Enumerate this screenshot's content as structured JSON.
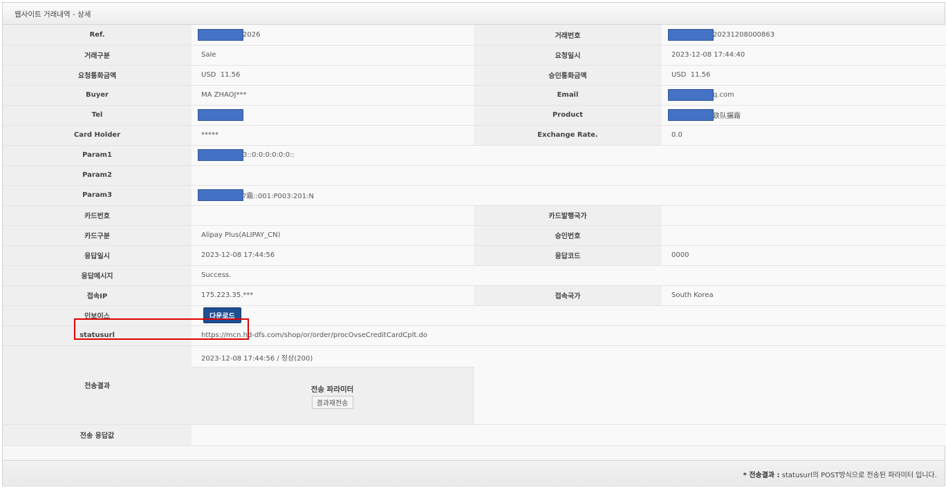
{
  "page": {
    "title": "웹사이트 거래내역 - 상세"
  },
  "rows": {
    "ref": {
      "label": "Ref.",
      "value": "2026"
    },
    "trade_no": {
      "label": "거래번호",
      "value": "20231208000863"
    },
    "trade_type": {
      "label": "거래구분",
      "value": "Sale"
    },
    "request_datetime": {
      "label": "요청일시",
      "value": "2023-12-08 17:44:40"
    },
    "request_amount": {
      "label": "요청통화금액",
      "value": "USD  11.56"
    },
    "approval_amount": {
      "label": "승인통화금액",
      "value": "USD  11.56"
    },
    "buyer": {
      "label": "Buyer",
      "value": "MA ZHAOJ***"
    },
    "email": {
      "label": "Email",
      "value": "q.com"
    },
    "tel": {
      "label": "Tel",
      "value": ""
    },
    "product": {
      "label": "Product",
      "value": "鉄队攦霜"
    },
    "card_holder": {
      "label": "Card Holder",
      "value": "*****"
    },
    "exchange_rate": {
      "label": "Exchange Rate.",
      "value": "0.0"
    },
    "param1": {
      "label": "Param1",
      "value": "3::0:0:0:0:0:0::"
    },
    "param2": {
      "label": "Param2",
      "value": ""
    },
    "param3": {
      "label": "Param3",
      "value": "?霜::001:P003:201:N"
    },
    "card_no": {
      "label": "카드번호",
      "value": ""
    },
    "card_country": {
      "label": "카드발행국가",
      "value": ""
    },
    "card_type": {
      "label": "카드구분",
      "value": "Alipay Plus(ALIPAY_CN)"
    },
    "approval_no": {
      "label": "승인번호",
      "value": ""
    },
    "response_datetime": {
      "label": "응답일시",
      "value": "2023-12-08 17:44:56"
    },
    "response_code": {
      "label": "응답코드",
      "value": "0000"
    },
    "response_message": {
      "label": "응답메시지",
      "value": "Success."
    },
    "access_ip": {
      "label": "접속IP",
      "value": "175.223.35.***"
    },
    "access_country": {
      "label": "접속국가",
      "value": "South Korea"
    },
    "invoice": {
      "label": "인보이스",
      "button": "다운로드"
    },
    "statusurl": {
      "label": "statusurl",
      "value": "https://mcn.hd-dfs.com/shop/or/order/procOvseCreditCardCplt.do"
    },
    "send_result": {
      "label": "전송결과",
      "time_status": "2023-12-08 17:44:56 / 정상(200)",
      "param_title": "전송 파라미터",
      "resend_button": "결과재전송"
    },
    "send_response": {
      "label": "전송 응답값",
      "value": ""
    }
  },
  "footer": {
    "note_bold": "* 전송결과 :",
    "note_text": " statusurl의 POST방식으로 전송된 파라미터 입니다."
  },
  "colors": {
    "mask": "#4472c4",
    "download_button": "#1e4f93",
    "highlight_box": "#e00000"
  }
}
